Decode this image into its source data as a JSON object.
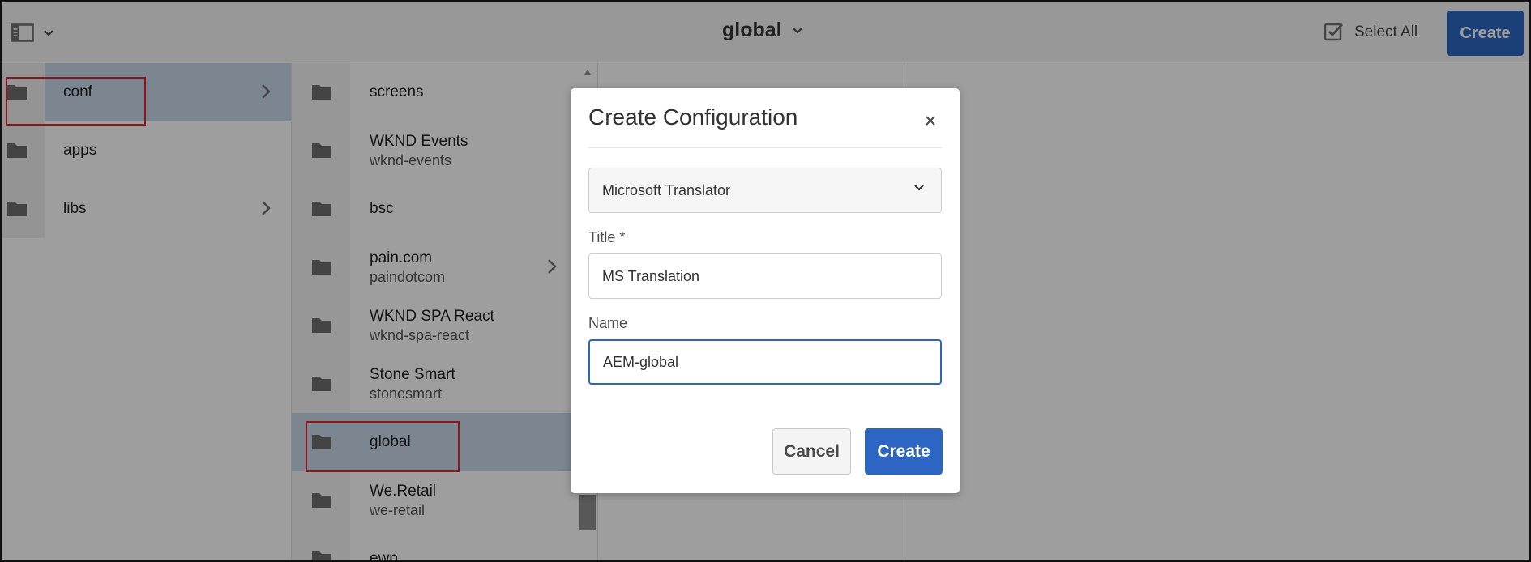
{
  "header": {
    "title": "global",
    "select_all_label": "Select All",
    "create_label": "Create"
  },
  "columns": {
    "root": [
      {
        "label": "conf",
        "has_children": true,
        "selected": true
      },
      {
        "label": "apps",
        "has_children": false
      },
      {
        "label": "libs",
        "has_children": true
      }
    ],
    "conf": [
      {
        "title": "screens",
        "name": ""
      },
      {
        "title": "WKND Events",
        "name": "wknd-events"
      },
      {
        "title": "bsc",
        "name": ""
      },
      {
        "title": "pain.com",
        "name": "paindotcom",
        "has_children": true
      },
      {
        "title": "WKND SPA React",
        "name": "wknd-spa-react"
      },
      {
        "title": "Stone Smart",
        "name": "stonesmart"
      },
      {
        "title": "global",
        "name": "",
        "selected": true
      },
      {
        "title": "We.Retail",
        "name": "we-retail"
      },
      {
        "title": "ewp",
        "name": ""
      }
    ]
  },
  "dialog": {
    "title": "Create Configuration",
    "type_select": {
      "value": "Microsoft Translator"
    },
    "title_field": {
      "label": "Title *",
      "value": "MS Translation"
    },
    "name_field": {
      "label": "Name",
      "value": "AEM-global"
    },
    "cancel_label": "Cancel",
    "create_label": "Create"
  },
  "colors": {
    "accent": "#2d66c2",
    "selected_row": "#c9d8ea",
    "highlight_box": "#e3262a"
  }
}
